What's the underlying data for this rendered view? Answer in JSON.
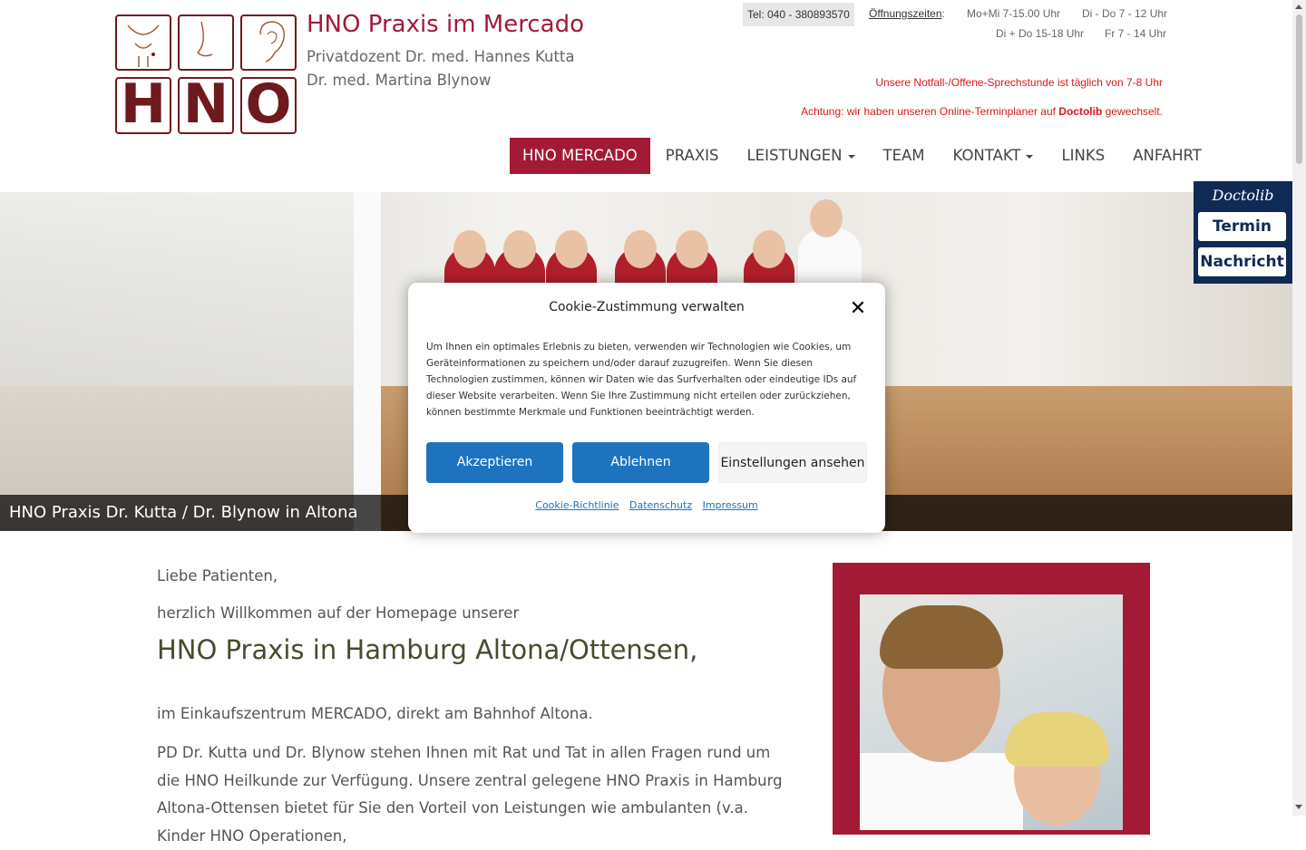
{
  "header": {
    "logo_text": "HNO",
    "site_title": "HNO Praxis im Mercado",
    "doctor1": "Privatdozent Dr. med. Hannes Kutta",
    "doctor2": "Dr. med. Martina Blynow",
    "phone": "Tel: 040 - 380893570",
    "hours_label": "Öffnungszeiten",
    "hours_sep": ":",
    "hours": [
      "Mo+Mi 7-15.00 Uhr",
      "Di - Do 7 - 12 Uhr",
      "Di + Do 15-18 Uhr",
      "Fr 7 - 14 Uhr"
    ],
    "notice1": "Unsere Notfall-/Offene-Sprechstunde ist täglich von 7-8 Uhr",
    "notice2_pre": "Achtung: wir haben unseren Online-Terminplaner auf ",
    "notice2_bold": "Doctolib",
    "notice2_post": " gewechselt."
  },
  "nav": {
    "items": [
      "HNO MERCADO",
      "PRAXIS",
      "LEISTUNGEN",
      "TEAM",
      "KONTAKT",
      "LINKS",
      "ANFAHRT"
    ]
  },
  "hero": {
    "caption": "HNO Praxis Dr. Kutta / Dr. Blynow in Altona"
  },
  "doctolib": {
    "brand": "Doctolib",
    "termin": "Termin",
    "nachricht": "Nachricht"
  },
  "content": {
    "greeting": "Liebe Patienten,",
    "welcome": "herzlich Willkommen auf der Homepage unserer",
    "heading": "HNO Praxis in Hamburg Altona/Ottensen,",
    "location": "im Einkaufszentrum MERCADO, direkt am Bahnhof Altona.",
    "body": "PD Dr. Kutta und Dr. Blynow stehen Ihnen mit Rat und Tat in allen Fragen rund um die HNO Heilkunde zur Verfügung. Unsere zentral gelegene HNO Praxis in Hamburg Altona-Ottensen bietet für Sie den Vorteil von Leistungen wie ambulanten (v.a. Kinder HNO Operationen,"
  },
  "cookie": {
    "title": "Cookie-Zustimmung verwalten",
    "text": "Um Ihnen ein optimales Erlebnis zu bieten, verwenden wir Technologien wie Cookies, um Geräteinformationen zu speichern und/oder darauf zuzugreifen. Wenn Sie diesen Technologien zustimmen, können wir Daten wie das Surfverhalten oder eindeutige IDs auf dieser Website verarbeiten. Wenn Sie Ihre Zustimmung nicht erteilen oder zurückziehen, können bestimmte Merkmale und Funktionen beeinträchtigt werden.",
    "accept": "Akzeptieren",
    "deny": "Ablehnen",
    "settings": "Einstellungen ansehen",
    "link_policy": "Cookie-Richtlinie",
    "link_privacy": "Datenschutz",
    "link_imprint": "Impressum"
  },
  "colors": {
    "brand": "#a31a36",
    "logo": "#6d1a1f",
    "notice": "#d61a1a",
    "button_blue": "#1e73be",
    "doctolib": "#0f2a55"
  },
  "icons": [
    "close-icon",
    "caret-down-icon"
  ]
}
